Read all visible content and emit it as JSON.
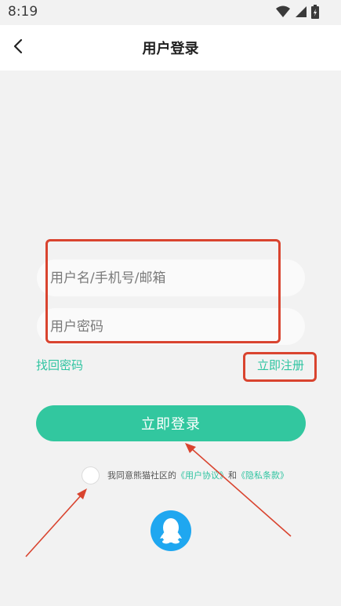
{
  "status_bar": {
    "time": "8:19",
    "icons": [
      "wifi-icon",
      "signal-icon",
      "battery-icon"
    ]
  },
  "header": {
    "title": "用户登录",
    "back_icon": "chevron-left-icon"
  },
  "form": {
    "username_placeholder": "用户名/手机号/邮箱",
    "password_placeholder": "用户密码",
    "forgot_password": "找回密码",
    "register": "立即注册",
    "login_button": "立即登录"
  },
  "agreement": {
    "prefix": "我同意熊猫社区的",
    "user_agreement": "《用户协议》",
    "and": "和",
    "privacy_policy": "《隐私条款》"
  },
  "third_party": {
    "qq_icon": "qq-penguin-icon"
  },
  "colors": {
    "accent": "#32c79f",
    "link": "#2fc4a1",
    "annotation": "#d9442f",
    "qq_blue": "#1fa7f0",
    "background": "#f2f2f2"
  }
}
